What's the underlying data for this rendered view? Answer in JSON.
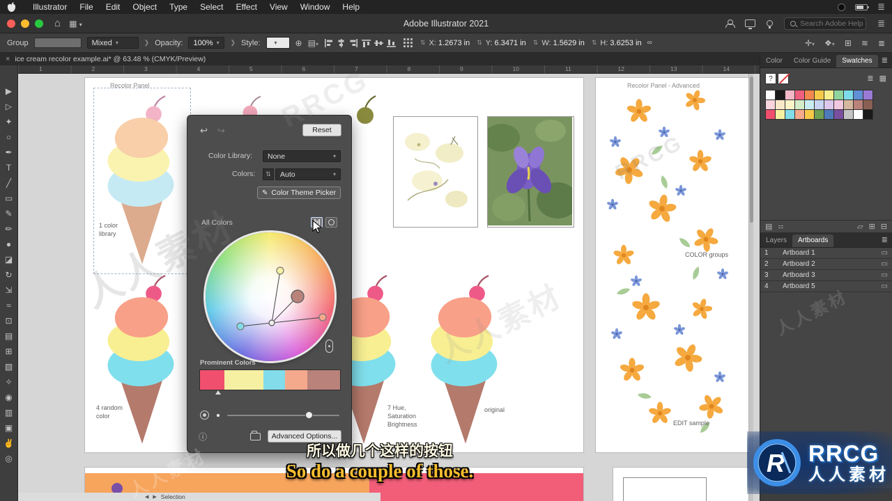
{
  "menubar": {
    "items": [
      "Illustrator",
      "File",
      "Edit",
      "Object",
      "Type",
      "Select",
      "Effect",
      "View",
      "Window",
      "Help"
    ]
  },
  "titlebar": {
    "title": "Adobe Illustrator 2021",
    "search_placeholder": "Search Adobe Help"
  },
  "controlbar": {
    "selection_label": "Group",
    "stroke_value": "Mixed",
    "opacity_label": "Opacity:",
    "opacity_value": "100%",
    "style_label": "Style:",
    "fields": [
      {
        "label": "X:",
        "value": "1.2673 in"
      },
      {
        "label": "Y:",
        "value": "6.3471 in"
      },
      {
        "label": "W:",
        "value": "1.5629 in"
      },
      {
        "label": "H:",
        "value": "3.6253 in"
      }
    ]
  },
  "document_tab": {
    "close": "×",
    "title": "ice cream recolor example.ai* @ 63.48 % (CMYK/Preview)"
  },
  "ruler": {
    "ticks": [
      "1",
      "2",
      "3",
      "4",
      "5",
      "6",
      "7",
      "8",
      "9",
      "10",
      "11",
      "12",
      "13",
      "14"
    ]
  },
  "tools": [
    {
      "name": "selection-tool",
      "glyph": "▶"
    },
    {
      "name": "direct-selection-tool",
      "glyph": "▷"
    },
    {
      "name": "magic-wand-tool",
      "glyph": "✦"
    },
    {
      "name": "lasso-tool",
      "glyph": "○"
    },
    {
      "name": "pen-tool",
      "glyph": "✒"
    },
    {
      "name": "type-tool",
      "glyph": "T"
    },
    {
      "name": "line-segment-tool",
      "glyph": "╱"
    },
    {
      "name": "rectangle-tool",
      "glyph": "▭"
    },
    {
      "name": "paintbrush-tool",
      "glyph": "✎"
    },
    {
      "name": "pencil-tool",
      "glyph": "✏"
    },
    {
      "name": "blob-brush-tool",
      "glyph": "●"
    },
    {
      "name": "eraser-tool",
      "glyph": "◪"
    },
    {
      "name": "rotate-tool",
      "glyph": "↻"
    },
    {
      "name": "scale-tool",
      "glyph": "⇲"
    },
    {
      "name": "width-tool",
      "glyph": "≈"
    },
    {
      "name": "free-transform-tool",
      "glyph": "⊡"
    },
    {
      "name": "shape-builder-tool",
      "glyph": "▤"
    },
    {
      "name": "mesh-tool",
      "glyph": "⊞"
    },
    {
      "name": "gradient-tool",
      "glyph": "▧"
    },
    {
      "name": "eyedropper-tool",
      "glyph": "✧"
    },
    {
      "name": "blend-tool",
      "glyph": "◉"
    },
    {
      "name": "column-graph-tool",
      "glyph": "▥"
    },
    {
      "name": "artboard-tool",
      "glyph": "▣"
    },
    {
      "name": "hand-tool",
      "glyph": "✌"
    },
    {
      "name": "zoom-tool",
      "glyph": "◎"
    }
  ],
  "statusbar": {
    "tool_label": "Selection"
  },
  "canvas": {
    "artboard1_title": "Recolor Panel",
    "artboard2_title": "Recolor Panel - Advanced",
    "caption_color_library": "1 color\nlibrary",
    "caption_random": "4 random\ncolor",
    "caption_hsb": "7 Hue,\nSaturation\nBrightness",
    "caption_original": "original",
    "caption_color_groups": "COLOR groups",
    "caption_edit_sample": "EDIT sample"
  },
  "recolor_dialog": {
    "reset_label": "Reset",
    "color_library_label": "Color Library:",
    "color_library_value": "None",
    "colors_label": "Colors:",
    "colors_value": "Auto",
    "theme_picker_label": "Color Theme Picker",
    "all_colors_label": "All Colors",
    "prominent_label": "Prominent Colors",
    "advanced_label": "Advanced Options...",
    "prominent_colors": [
      {
        "color": "#f0506e",
        "flex": "40"
      },
      {
        "color": "#f6f0a2",
        "flex": "64"
      },
      {
        "color": "#82dcea",
        "flex": "36"
      },
      {
        "color": "#f5a98c",
        "flex": "36"
      },
      {
        "color": "#b9827a",
        "flex": "54"
      }
    ]
  },
  "artwork": {
    "pastel": [
      "#f2b4c6",
      "#c08aa8",
      "#f8cfa9",
      "#faf3af",
      "#c6eaf3",
      "#dcab8e"
    ],
    "bright": [
      "#ee5a88",
      "#a85568",
      "#f8a088",
      "#f8ef93",
      "#80dfec",
      "#b47a6c"
    ],
    "pale": [
      "#f4a9bb",
      "#a88a98",
      "#f6e9b2",
      "#f6e9b2",
      "#f6e9b2",
      "#d9c49a"
    ]
  },
  "panels": {
    "top_tabs": [
      "Color",
      "Color Guide",
      "Swatches"
    ],
    "swatches": {
      "unknown_label": "?",
      "row1": [
        "#ffffff",
        "#1a1a1a",
        "#f2b8c8",
        "#ef5f7e",
        "#f2884f",
        "#f7c948",
        "#f7ef8e",
        "#8fd49f",
        "#7edcea",
        "#5f8fd4",
        "#9a7ad4"
      ],
      "row2": [
        "#f7d4de",
        "#f9e8c8",
        "#fbf4c8",
        "#d4ecc8",
        "#c8ecf2",
        "#c8d4f2",
        "#dcc8ec",
        "#f2c8e0",
        "#d4b89f",
        "#b9827a",
        "#8a5f54"
      ],
      "row3": [
        "#f0506e",
        "#f6f0a2",
        "#82dcea",
        "#f5a98c",
        "#f7c948",
        "#6f9f54",
        "#4f7ab9",
        "#7a4f9f",
        "#c4c4c4",
        "#ffffff",
        "#1a1a1a"
      ]
    },
    "bottom_tabs": [
      "Layers",
      "Artboards"
    ],
    "artboards": [
      {
        "num": "1",
        "name": "Artboard 1"
      },
      {
        "num": "2",
        "name": "Artboard 2"
      },
      {
        "num": "3",
        "name": "Artboard 3"
      },
      {
        "num": "4",
        "name": "Artboard 5"
      }
    ]
  },
  "subtitles": {
    "zh": "所以做几个这样的按钮",
    "en": "So do a couple of those."
  },
  "logo": {
    "brand": "RRCG",
    "cn": "人人素材"
  },
  "watermark": {
    "brand": "RRCG",
    "cn": "人人素材"
  }
}
